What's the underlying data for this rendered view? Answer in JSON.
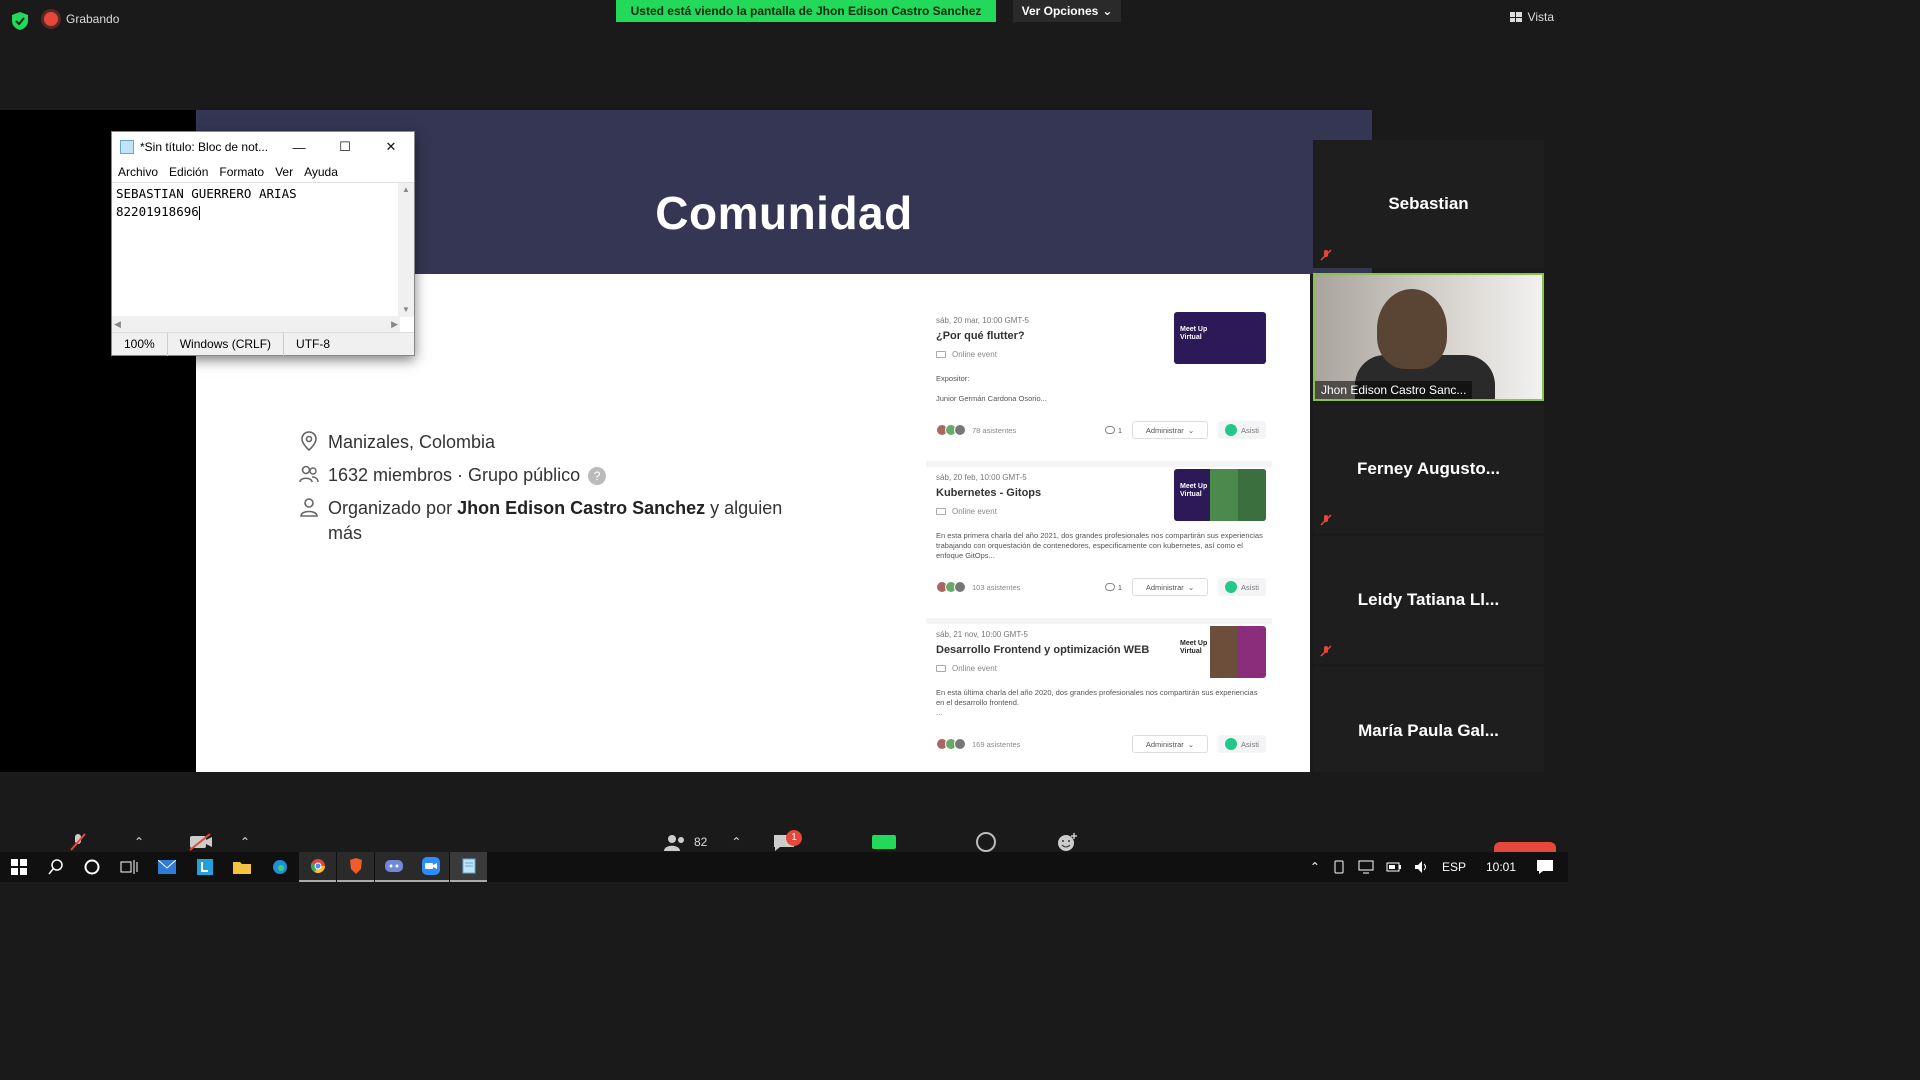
{
  "zoom": {
    "recording_label": "Grabando",
    "viewing_banner": "Usted está viendo la pantalla de Jhon Edison Castro Sanchez",
    "view_options": "Ver Opciones",
    "view_label": "Vista",
    "participants_count": "82",
    "chat_badge": "1"
  },
  "slide": {
    "title": "Comunidad",
    "location": "Manizales, Colombia",
    "members": "1632 miembros · Grupo público",
    "help": "?",
    "organized_prefix": "Organizado por",
    "organizer": "Jhon Edison Castro Sanchez",
    "organized_suffix": "y alguien",
    "organized_suffix2": "más"
  },
  "events": [
    {
      "date": "sáb, 20 mar, 10:00 GMT-5",
      "title": "¿Por qué flutter?",
      "online": "Online event",
      "desc_line1": "Expositor:",
      "desc_line2": "Junior Germán Cardona Osorio...",
      "attendees": "78 asistentes",
      "comments": "1",
      "admin": "Administrar",
      "rsvp": "Asisti",
      "thumb": "Meet Up Virtual"
    },
    {
      "date": "sáb, 20 feb, 10:00 GMT-5",
      "title": "Kubernetes - Gitops",
      "online": "Online event",
      "desc_line1": "En esta primera charla del año 2021, dos grandes profesionales nos compartirán sus experiencias trabajando con orquestación de contenedores, especificamente con kubernetes, así como el enfoque GitOps...",
      "desc_line2": "",
      "attendees": "103 asistentes",
      "comments": "1",
      "admin": "Administrar",
      "rsvp": "Asisti",
      "thumb": "Meet Up Virtual"
    },
    {
      "date": "sáb, 21 nov, 10:00 GMT-5",
      "title": "Desarrollo Frontend y optimización WEB",
      "online": "Online event",
      "desc_line1": "En esta última charla del año 2020, dos grandes profesionales nos compartirán sus experiencias en el desarrollo frontend.",
      "desc_line2": "...",
      "attendees": "169 asistentes",
      "comments": "",
      "admin": "Administrar",
      "rsvp": "Asisti",
      "thumb": "Meet Up Virtual"
    }
  ],
  "notepad": {
    "title": "*Sin título: Bloc de not...",
    "menu": [
      "Archivo",
      "Edición",
      "Formato",
      "Ver",
      "Ayuda"
    ],
    "line1": "SEBASTIAN GUERRERO ARIAS",
    "line2": "82201918696",
    "zoom": "100%",
    "eol": "Windows (CRLF)",
    "encoding": "UTF-8"
  },
  "participants": [
    {
      "name": "Sebastian"
    },
    {
      "name": "Jhon Edison Castro Sanc..."
    },
    {
      "name": "Ferney  Augusto..."
    },
    {
      "name": "Leidy  Tatiana  Ll..."
    },
    {
      "name": "María  Paula  Gal..."
    }
  ],
  "taskbar": {
    "lang": "ESP",
    "time": "10:01"
  }
}
